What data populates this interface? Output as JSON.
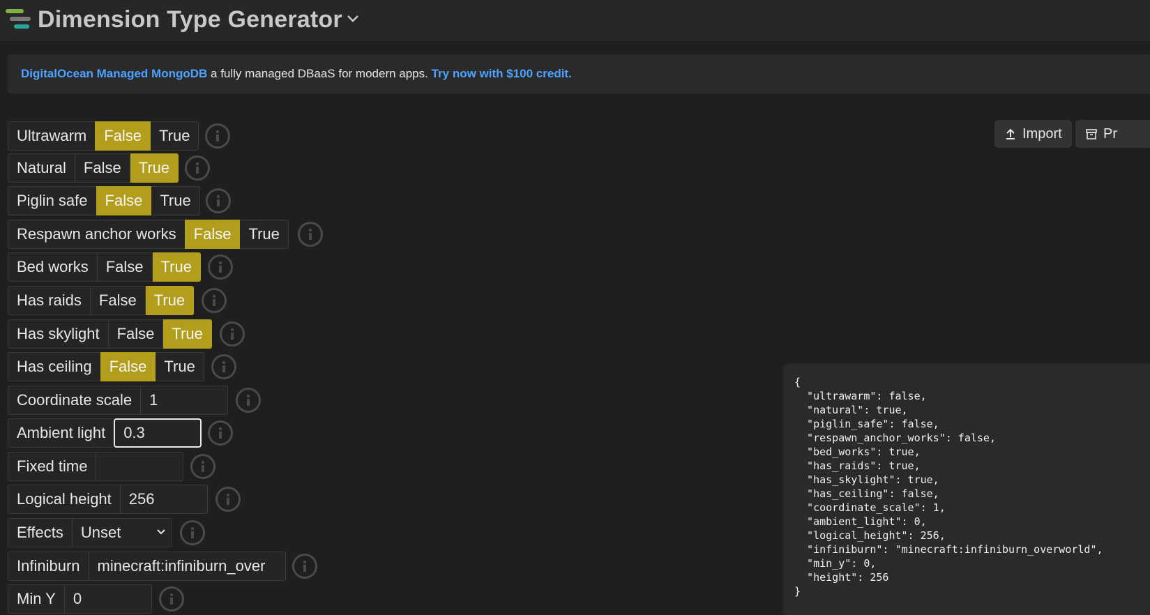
{
  "header": {
    "title": "Dimension Type Generator"
  },
  "ad": {
    "link1": "DigitalOcean Managed MongoDB",
    "text": " a fully managed DBaaS for modern apps. ",
    "link2": "Try now with $100 credit."
  },
  "buttons": {
    "import": "Import",
    "preset": "Pr"
  },
  "options": {
    "false": "False",
    "true": "True"
  },
  "fields": {
    "ultrawarm": {
      "label": "Ultrawarm",
      "value": "False"
    },
    "natural": {
      "label": "Natural",
      "value": "True"
    },
    "piglin_safe": {
      "label": "Piglin safe",
      "value": "False"
    },
    "respawn_anchor_works": {
      "label": "Respawn anchor works",
      "value": "False"
    },
    "bed_works": {
      "label": "Bed works",
      "value": "True"
    },
    "has_raids": {
      "label": "Has raids",
      "value": "True"
    },
    "has_skylight": {
      "label": "Has skylight",
      "value": "True"
    },
    "has_ceiling": {
      "label": "Has ceiling",
      "value": "False"
    },
    "coordinate_scale": {
      "label": "Coordinate scale",
      "value": "1"
    },
    "ambient_light": {
      "label": "Ambient light",
      "value": "0.3"
    },
    "fixed_time": {
      "label": "Fixed time",
      "value": ""
    },
    "logical_height": {
      "label": "Logical height",
      "value": "256"
    },
    "effects": {
      "label": "Effects",
      "value": "Unset"
    },
    "infiniburn": {
      "label": "Infiniburn",
      "value": "minecraft:infiniburn_over"
    },
    "min_y": {
      "label": "Min Y",
      "value": "0"
    }
  },
  "json_output": "{\n  \"ultrawarm\": false,\n  \"natural\": true,\n  \"piglin_safe\": false,\n  \"respawn_anchor_works\": false,\n  \"bed_works\": true,\n  \"has_raids\": true,\n  \"has_skylight\": true,\n  \"has_ceiling\": false,\n  \"coordinate_scale\": 1,\n  \"ambient_light\": 0,\n  \"logical_height\": 256,\n  \"infiniburn\": \"minecraft:infiniburn_overworld\",\n  \"min_y\": 0,\n  \"height\": 256\n}",
  "colors": {
    "accent": "#b29e1a",
    "link": "#4da3ff",
    "background": "#1f1f1f"
  }
}
